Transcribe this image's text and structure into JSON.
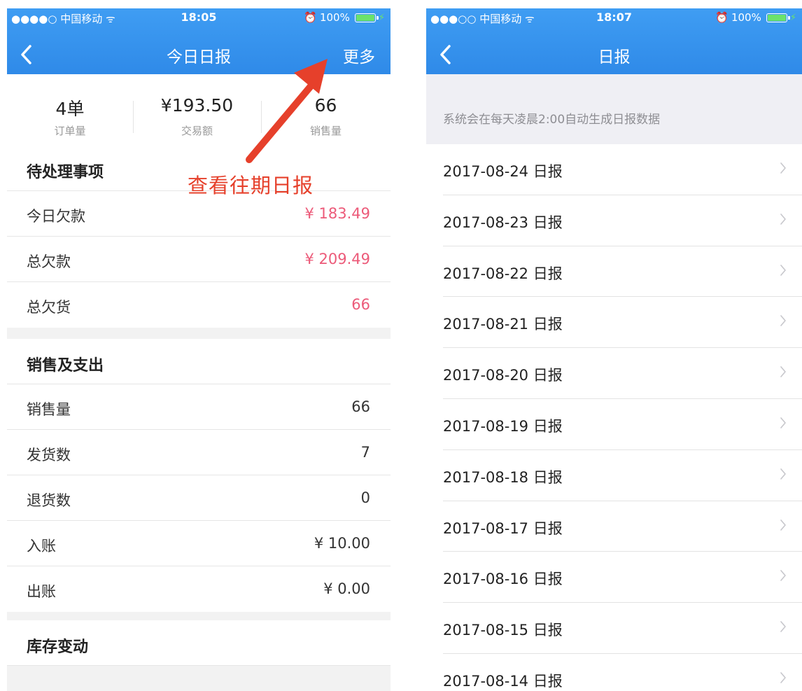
{
  "left": {
    "status": {
      "carrier": "●●●●○ 中国移动 ᯤ",
      "time": "18:05",
      "battery": "100%"
    },
    "nav": {
      "title": "今日日报",
      "more": "更多"
    },
    "summary": [
      {
        "value": "4单",
        "label": "订单量"
      },
      {
        "value": "¥193.50",
        "label": "交易额"
      },
      {
        "value": "66",
        "label": "销售量"
      }
    ],
    "annotation": "查看往期日报",
    "pending": {
      "header": "待处理事项",
      "rows": [
        {
          "label": "今日欠款",
          "value": "¥ 183.49"
        },
        {
          "label": "总欠款",
          "value": "¥ 209.49"
        },
        {
          "label": "总欠货",
          "value": "66"
        }
      ]
    },
    "sales": {
      "header": "销售及支出",
      "rows": [
        {
          "label": "销售量",
          "value": "66"
        },
        {
          "label": "发货数",
          "value": "7"
        },
        {
          "label": "退货数",
          "value": "0"
        },
        {
          "label": "入账",
          "value": "¥ 10.00"
        },
        {
          "label": "出账",
          "value": "¥ 0.00"
        }
      ]
    },
    "inventory": {
      "header": "库存变动"
    }
  },
  "right": {
    "status": {
      "carrier": "●●●○○ 中国移动 ᯤ",
      "time": "18:07",
      "battery": "100%"
    },
    "nav": {
      "title": "日报"
    },
    "notice": "系统会在每天凌晨2:00自动生成日报数据",
    "reports": [
      "2017-08-24 日报",
      "2017-08-23 日报",
      "2017-08-22 日报",
      "2017-08-21 日报",
      "2017-08-20 日报",
      "2017-08-19 日报",
      "2017-08-18 日报",
      "2017-08-17 日报",
      "2017-08-16 日报",
      "2017-08-15 日报",
      "2017-08-14 日报"
    ]
  },
  "colors": {
    "nav": "#2f8ae8",
    "debt": "#ec5a79",
    "annotation": "#e6402b"
  }
}
